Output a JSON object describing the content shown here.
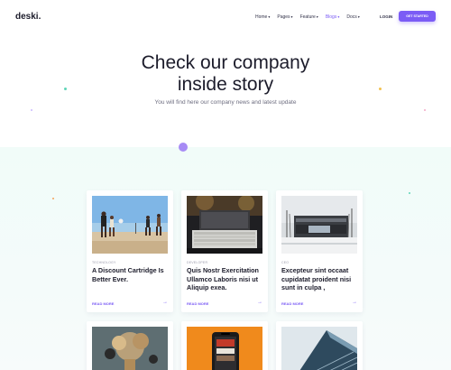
{
  "header": {
    "logo": "deski.",
    "nav": [
      {
        "label": "Home",
        "caret": "▾",
        "active": false
      },
      {
        "label": "Pages",
        "caret": "▾",
        "active": false
      },
      {
        "label": "Feature",
        "caret": "▾",
        "active": false
      },
      {
        "label": "Blogs",
        "caret": "▾",
        "active": true
      },
      {
        "label": "Docs",
        "caret": "▾",
        "active": false
      }
    ],
    "login_label": "LOGIN",
    "cta_label": "GET STARTED"
  },
  "hero": {
    "title_line1": "Check our company",
    "title_line2": "inside story",
    "subtitle": "You will find here our company news and latest update"
  },
  "colors": {
    "accent": "#7b5cf5",
    "text": "#1c1c2b",
    "section_bg": "#f1fcf9"
  },
  "cards": [
    {
      "category": "TECHNOLOGY",
      "title": "A Discount Cartridge Is Better Ever.",
      "read_more": "READ MORE",
      "arrow": "→",
      "image": "beach-volleyball-photo"
    },
    {
      "category": "DEVELOPER",
      "title": "Quis Nostr Exercitation Ullamco Laboris nisi ut Aliquip exea.",
      "read_more": "READ MORE",
      "arrow": "→",
      "image": "keyboard-workspace-photo"
    },
    {
      "category": "CEO",
      "title": "Excepteur sint occaat cupidatat proident nisi sunt in culpa ,",
      "read_more": "READ MORE",
      "arrow": "→",
      "image": "modern-building-photo"
    },
    {
      "category": "",
      "title": "",
      "read_more": "",
      "arrow": "",
      "image": "dried-flowers-photo"
    },
    {
      "category": "",
      "title": "",
      "read_more": "",
      "arrow": "",
      "image": "smartphone-orange-photo"
    },
    {
      "category": "",
      "title": "",
      "read_more": "",
      "arrow": "",
      "image": "glass-tower-photo"
    }
  ]
}
